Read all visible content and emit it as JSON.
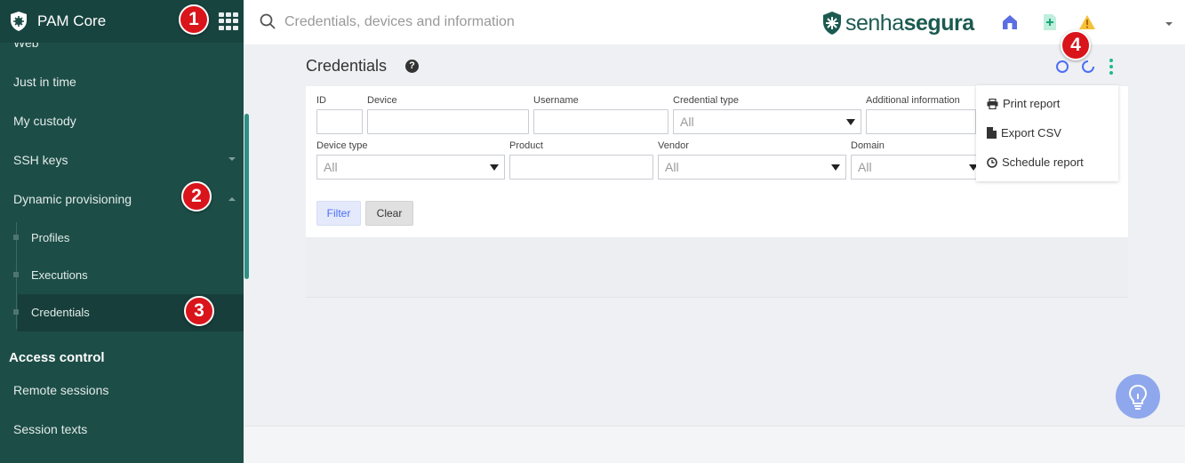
{
  "app": {
    "title": "PAM Core"
  },
  "sidebar": {
    "items": [
      {
        "label": "Web"
      },
      {
        "label": "Just in time"
      },
      {
        "label": "My custody"
      },
      {
        "label": "SSH keys"
      },
      {
        "label": "Dynamic provisioning"
      }
    ],
    "subitems": [
      {
        "label": "Profiles"
      },
      {
        "label": "Executions"
      },
      {
        "label": "Credentials"
      }
    ],
    "section_access": "Access control",
    "access_items": [
      {
        "label": "Remote sessions"
      },
      {
        "label": "Session texts"
      }
    ]
  },
  "search": {
    "placeholder": "Credentials, devices and information"
  },
  "brand": {
    "part1": "senha",
    "part2": "segura"
  },
  "page": {
    "title": "Credentials"
  },
  "filters": {
    "id_label": "ID",
    "device_label": "Device",
    "username_label": "Username",
    "credential_type_label": "Credential type",
    "credential_type_value": "All",
    "additional_info_label": "Additional information",
    "device_type_label": "Device type",
    "device_type_value": "All",
    "product_label": "Product",
    "vendor_label": "Vendor",
    "vendor_value": "All",
    "domain_label": "Domain",
    "domain_value": "All",
    "filter_button": "Filter",
    "clear_button": "Clear"
  },
  "menu": {
    "items": [
      {
        "label": "Print report"
      },
      {
        "label": "Export CSV"
      },
      {
        "label": "Schedule report"
      }
    ]
  },
  "annotations": [
    "1",
    "2",
    "3",
    "4"
  ],
  "colors": {
    "sidebar": "#1d4d47",
    "brand": "#1b5a50",
    "accent": "#4c6ef5",
    "badge": "#d9141b",
    "kebab": "#21b98a"
  }
}
